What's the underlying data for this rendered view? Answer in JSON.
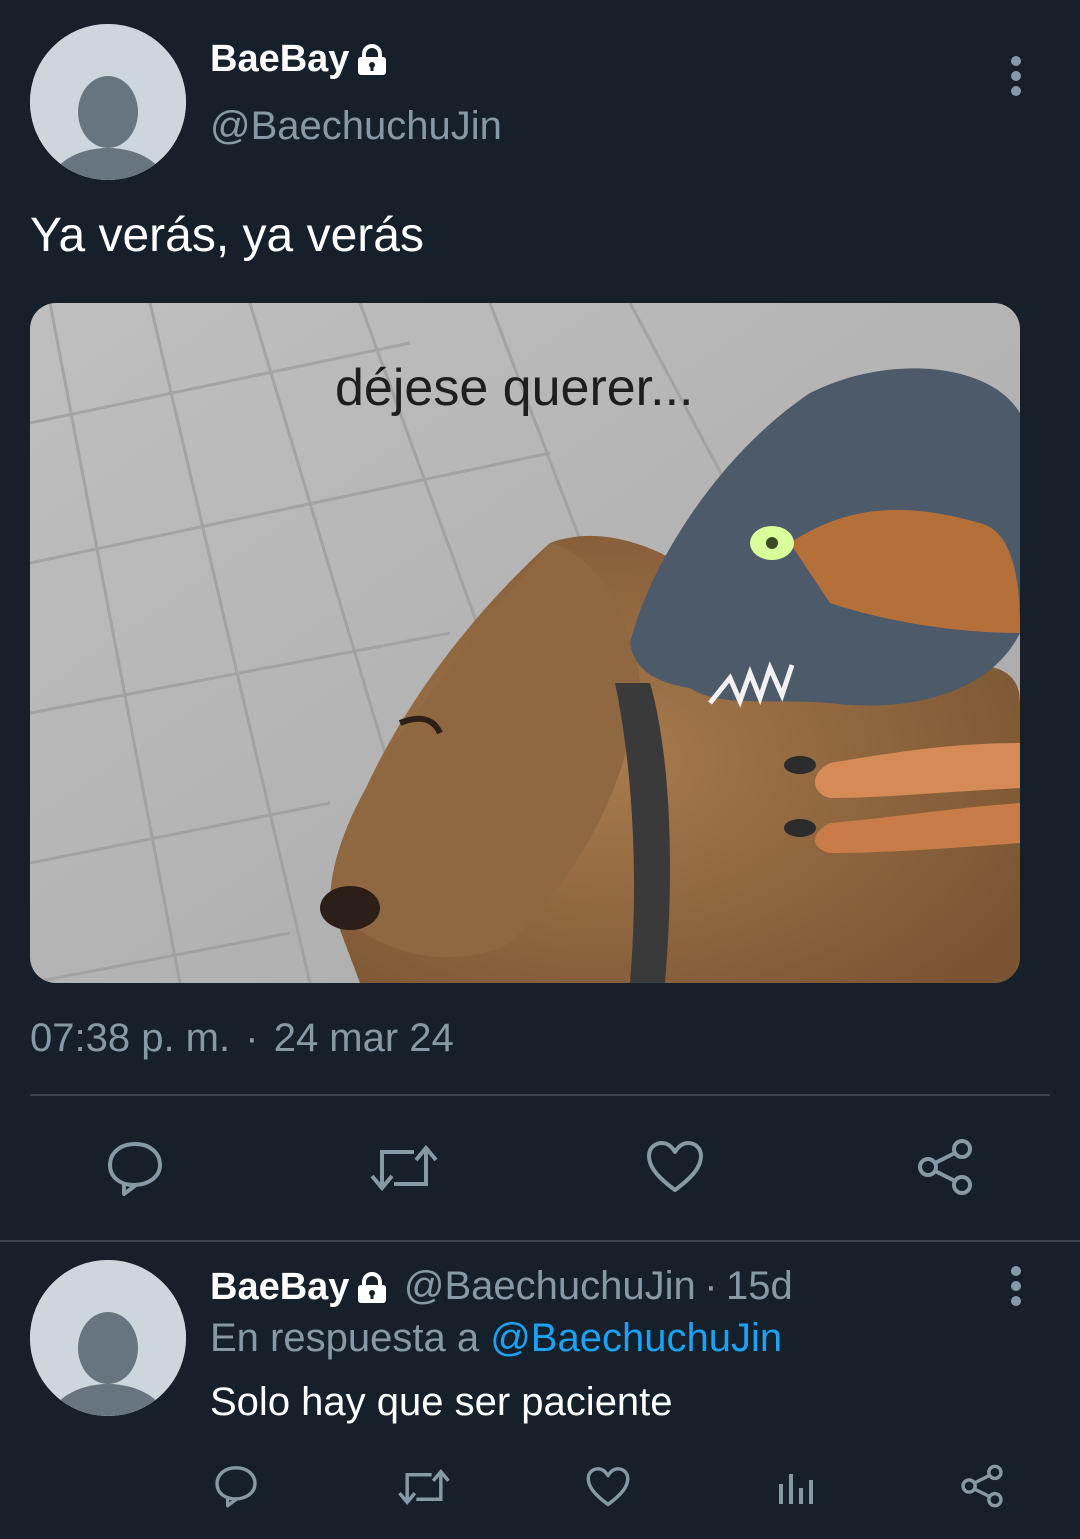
{
  "tweet": {
    "author_name": "BaeBay",
    "author_handle": "@BaechuchuJin",
    "text": "Ya verás, ya verás",
    "media_caption": "déjese querer...",
    "timestamp": "07:38 p. m.",
    "date": "24 mar 24",
    "separator": "·",
    "actions": [
      "reply-icon",
      "retweet-icon",
      "like-icon",
      "share-icon"
    ]
  },
  "reply": {
    "author_name": "BaeBay",
    "author_handle": "@BaechuchuJin",
    "separator": "·",
    "age": "15d",
    "reply_prefix": "En respuesta a",
    "reply_target": "@BaechuchuJin",
    "text": "Solo hay que ser paciente",
    "actions": [
      "reply-icon",
      "retweet-icon",
      "like-icon",
      "analytics-icon",
      "share-icon"
    ]
  },
  "colors": {
    "background": "#15202b",
    "secondary_text": "#8899a6",
    "accent": "#1da1f2",
    "divider": "#38444d"
  }
}
